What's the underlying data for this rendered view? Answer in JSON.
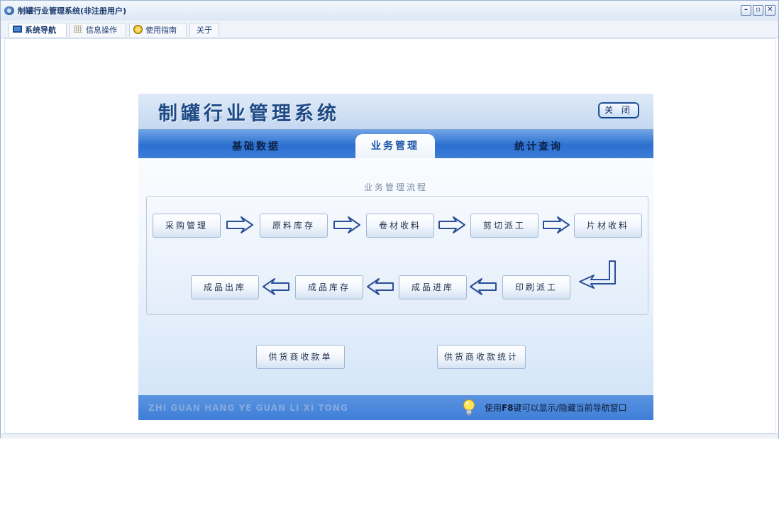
{
  "window": {
    "title": "制罐行业管理系统(非注册用户)",
    "controls": [
      "minimize",
      "restore",
      "close"
    ]
  },
  "tabs": [
    {
      "label": "系统导航",
      "icon": "monitor-icon",
      "active": true
    },
    {
      "label": "信息操作",
      "icon": "grid-icon",
      "active": false
    },
    {
      "label": "使用指南",
      "icon": "help-icon",
      "active": false
    },
    {
      "label": "关于",
      "icon": "",
      "active": false
    }
  ],
  "panel": {
    "title": "制罐行业管理系统",
    "close_label": "关 闭",
    "subtabs": [
      {
        "label": "基础数据",
        "active": false
      },
      {
        "label": "业务管理",
        "active": true
      },
      {
        "label": "统计查询",
        "active": false
      }
    ],
    "flow_caption": "业务管理流程",
    "flow_row1": [
      "采购管理",
      "原料库存",
      "卷材收料",
      "剪切派工",
      "片材收料"
    ],
    "flow_row2": [
      "成品出库",
      "成品库存",
      "成品进库",
      "印刷派工"
    ],
    "extra_buttons": [
      "供货商收款单",
      "供货商收款统计"
    ],
    "footer_text": "ZHI GUAN HANG YE GUAN LI XI TONG",
    "tip": {
      "prefix": "使用",
      "key": "F8",
      "suffix": "键可以显示/隐藏当前导航窗口"
    }
  },
  "colors": {
    "accent": "#2b6fd0",
    "title": "#1e4a86",
    "button_border": "#9fb6d4"
  }
}
